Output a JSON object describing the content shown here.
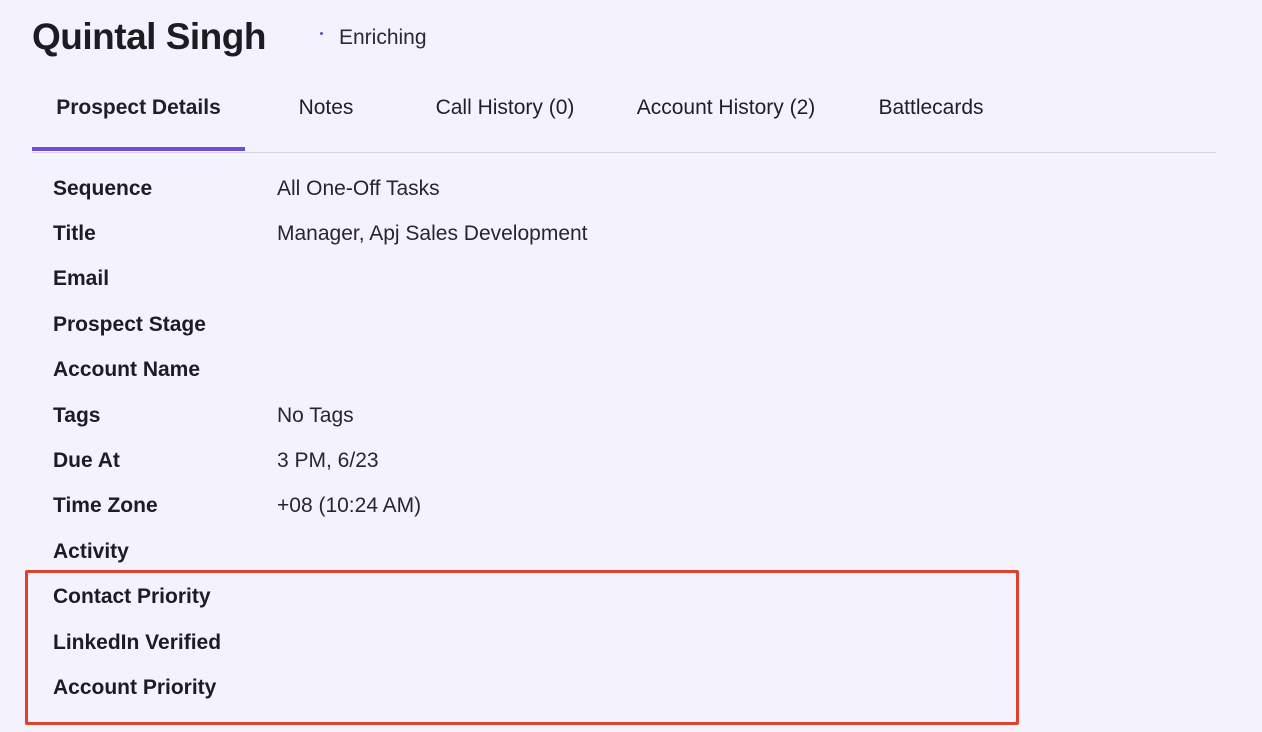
{
  "header": {
    "prospect_name": "Quintal Singh",
    "status": "Enriching"
  },
  "tabs": [
    {
      "label": "Prospect Details",
      "active": true
    },
    {
      "label": "Notes",
      "active": false
    },
    {
      "label": "Call History (0)",
      "active": false
    },
    {
      "label": "Account History (2)",
      "active": false
    },
    {
      "label": "Battlecards",
      "active": false
    }
  ],
  "details": [
    {
      "label": "Sequence",
      "value": "All One-Off Tasks"
    },
    {
      "label": "Title",
      "value": "Manager, Apj Sales Development"
    },
    {
      "label": "Email",
      "value": ""
    },
    {
      "label": "Prospect Stage",
      "value": ""
    },
    {
      "label": "Account Name",
      "value": ""
    },
    {
      "label": "Tags",
      "value": "No Tags"
    },
    {
      "label": "Due At",
      "value": "3 PM, 6/23"
    },
    {
      "label": "Time Zone",
      "value": "+08 (10:24 AM)"
    },
    {
      "label": "Activity",
      "value": ""
    },
    {
      "label": "Contact Priority",
      "value": ""
    },
    {
      "label": "LinkedIn Verified",
      "value": ""
    },
    {
      "label": "Account Priority",
      "value": ""
    }
  ],
  "colors": {
    "background": "#f4f2fc",
    "active_tab_underline": "#6f4bd8",
    "highlight_box": "#e2402f",
    "status_dot": "#5b4fc4"
  }
}
